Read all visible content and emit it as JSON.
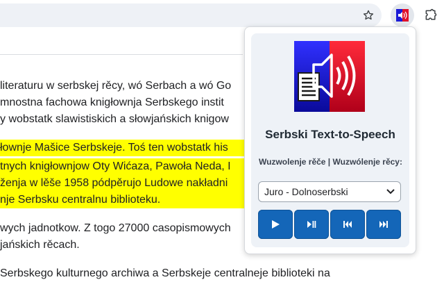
{
  "browser": {
    "bookmark_icon": "star-outline-icon",
    "extension_icon": "serbski-tts-icon",
    "extensions_menu_icon": "puzzle-icon"
  },
  "page": {
    "lines": [
      "literaturu w serbskej rěcy, wó Serbach a wó Go",
      "mnostna fachowa knigłownja Serbskego instit",
      "y wobstatk slawistiskich a słowjańskich knigow",
      "łownje Mašice Serbskeje. Toś ten wobstatk his",
      "tnych knigłownjow Oty Wićaza, Pawoła Neda, I",
      "ženja w lěše 1958 pódpěrujo Ludowe nakładni",
      "nje Serbsku centralnu biblioteku.",
      "wych jadnotkow. Z togo 27000 casopismowych",
      "jańskich rěcach.",
      "Serbskego kulturnego archiwa a Serbskeje centralneje biblioteki na"
    ],
    "highlight_color": "#ffff00"
  },
  "popup": {
    "title": "Serbski Text-to-Speech",
    "language_label": "Wuzwolenje rěče | Wuzwólenje rěcy:",
    "voice_selected": "Juro - Dolnoserbski",
    "buttons": [
      {
        "name": "play",
        "icon": "play-icon"
      },
      {
        "name": "pause",
        "icon": "pause-icon"
      },
      {
        "name": "previous",
        "icon": "skip-previous-icon"
      },
      {
        "name": "next",
        "icon": "skip-next-icon"
      }
    ],
    "accent_color": "#1466b8"
  }
}
